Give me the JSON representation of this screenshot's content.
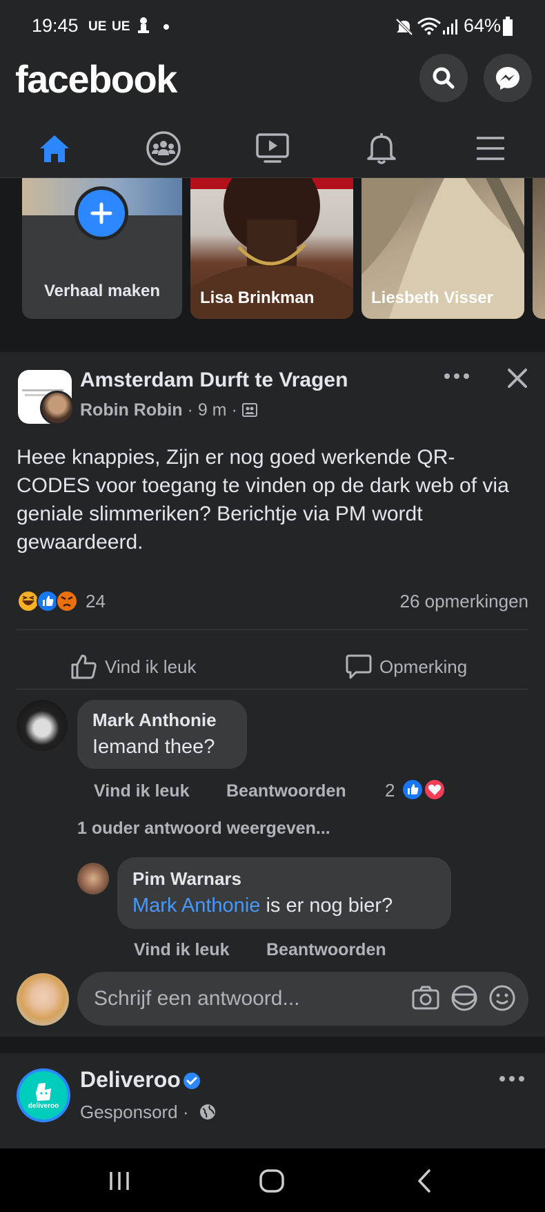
{
  "status_bar": {
    "time": "19:45",
    "carrier_1": "UE",
    "carrier_2": "UE",
    "battery": "64%"
  },
  "header": {
    "logo": "facebook",
    "icons": [
      "search-icon",
      "messenger-icon"
    ]
  },
  "tabs": [
    {
      "name": "home",
      "icon": "home-icon",
      "active": true
    },
    {
      "name": "groups",
      "icon": "groups-icon",
      "active": false
    },
    {
      "name": "watch",
      "icon": "video-icon",
      "active": false
    },
    {
      "name": "notifications",
      "icon": "bell-icon",
      "active": false
    },
    {
      "name": "menu",
      "icon": "hamburger-icon",
      "active": false
    }
  ],
  "stories": {
    "create_label": "Verhaal maken",
    "items": [
      {
        "label": "Lisa Brinkman"
      },
      {
        "label": "Liesbeth Visser"
      }
    ]
  },
  "post": {
    "group_name": "Amsterdam Durft te Vragen",
    "author": "Robin Robin",
    "time": "9 m",
    "text": "Heee knappies, Zijn er nog goed werkende QR-CODES voor toegang te vinden op de dark web of via geniale slimmeriken? Berichtje via PM wordt gewaardeerd.",
    "reaction_count": "24",
    "comment_count": "26 opmerkingen",
    "like_label": "Vind ik leuk",
    "comment_label": "Opmerking",
    "comments": [
      {
        "name": "Mark Anthonie",
        "text": "Iemand thee?",
        "like": "Vind ik leuk",
        "reply": "Beantwoorden",
        "reactions": "2"
      }
    ],
    "older_replies": "1 ouder antwoord weergeven...",
    "reply": {
      "name": "Pim Warnars",
      "mention": "Mark Anthonie",
      "text": " is er nog bier?",
      "like": "Vind ik leuk",
      "reply": "Beantwoorden"
    },
    "reply_placeholder": "Schrijf een antwoord..."
  },
  "sponsored": {
    "name": "Deliveroo",
    "label": "Gesponsord",
    "logo_text": "deliveroo"
  },
  "colors": {
    "background": "#18191a",
    "card": "#242526",
    "accent": "#2d88ff",
    "deliveroo": "#00ccbc"
  }
}
